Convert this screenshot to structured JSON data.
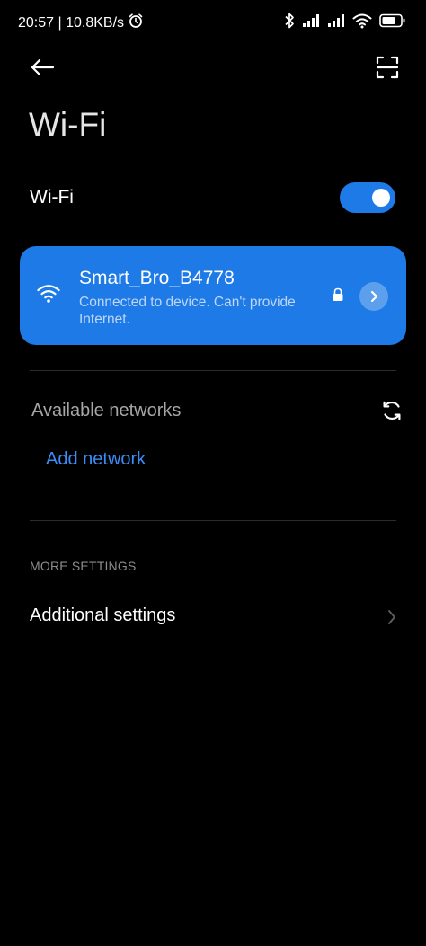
{
  "status_bar": {
    "time_speed": "20:57 | 10.8KB/s",
    "icons": [
      "alarm-icon",
      "bluetooth-icon",
      "signal-icon",
      "signal-icon",
      "wifi-icon",
      "battery-icon"
    ]
  },
  "top_bar": {
    "back_icon": "arrow-left-icon",
    "scan_icon": "scan-frame-icon"
  },
  "page": {
    "title": "Wi-Fi"
  },
  "wifi_toggle": {
    "label": "Wi-Fi",
    "enabled": true
  },
  "connected_network": {
    "ssid": "Smart_Bro_B4778",
    "status": "Connected to device. Can't provide Internet.",
    "icons": [
      "wifi-icon",
      "lock-icon",
      "chevron-right-icon"
    ]
  },
  "available_networks": {
    "label": "Available networks",
    "refresh_icon": "refresh-icon",
    "add_network_label": "Add network"
  },
  "more_settings": {
    "header": "MORE SETTINGS",
    "additional_label": "Additional settings",
    "chevron_icon": "chevron-right-icon"
  },
  "colors": {
    "background": "#000000",
    "accent": "#1e7ae6",
    "link": "#3b8cf5",
    "muted_text": "#a6a6a6"
  }
}
